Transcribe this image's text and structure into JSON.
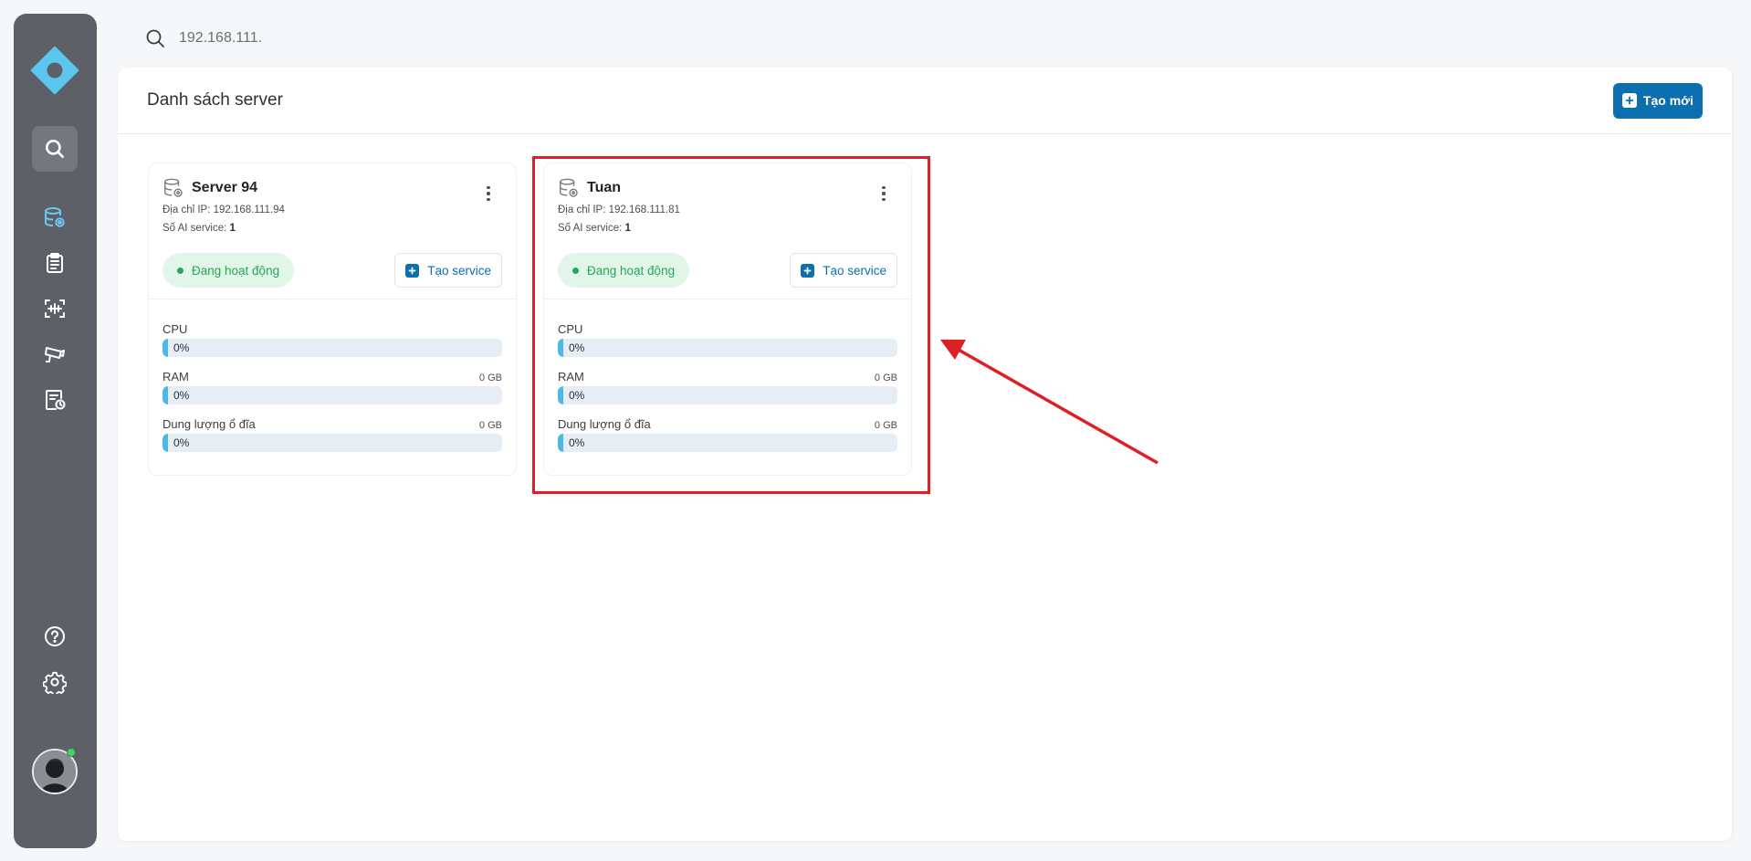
{
  "search": {
    "value": "192.168.111."
  },
  "panel": {
    "title": "Danh sách server",
    "create_label": "Tạo mới"
  },
  "sidebar": {
    "items": [
      {
        "icon": "logo-icon"
      },
      {
        "icon": "search-icon"
      },
      {
        "icon": "server-icon"
      },
      {
        "icon": "clipboard-icon"
      },
      {
        "icon": "face-scan-icon"
      },
      {
        "icon": "camera-icon"
      },
      {
        "icon": "report-clock-icon"
      },
      {
        "icon": "help-icon"
      },
      {
        "icon": "settings-icon"
      }
    ]
  },
  "servers": [
    {
      "name": "Server 94",
      "ip_label": "Địa chỉ IP:",
      "ip": "192.168.111.94",
      "ai_label": "Số AI service:",
      "ai_count": "1",
      "status": "Đang hoạt động",
      "create_service": "Tạo service",
      "metrics": [
        {
          "label": "CPU",
          "cap": "",
          "value": "0%"
        },
        {
          "label": "RAM",
          "cap": "0 GB",
          "value": "0%"
        },
        {
          "label": "Dung lượng ổ đĩa",
          "cap": "0 GB",
          "value": "0%"
        }
      ]
    },
    {
      "name": "Tuan",
      "ip_label": "Địa chỉ IP:",
      "ip": "192.168.111.81",
      "ai_label": "Số AI service:",
      "ai_count": "1",
      "status": "Đang hoạt động",
      "create_service": "Tạo service",
      "metrics": [
        {
          "label": "CPU",
          "cap": "",
          "value": "0%"
        },
        {
          "label": "RAM",
          "cap": "0 GB",
          "value": "0%"
        },
        {
          "label": "Dung lượng ổ đĩa",
          "cap": "0 GB",
          "value": "0%"
        }
      ]
    }
  ],
  "colors": {
    "sidebar": "#5d6167",
    "primary": "#0b6fb0",
    "status_bg": "#e2f5e9",
    "status_text": "#27a55a",
    "bar_fill": "#4bb8e8",
    "annotation": "#dd1f26"
  }
}
